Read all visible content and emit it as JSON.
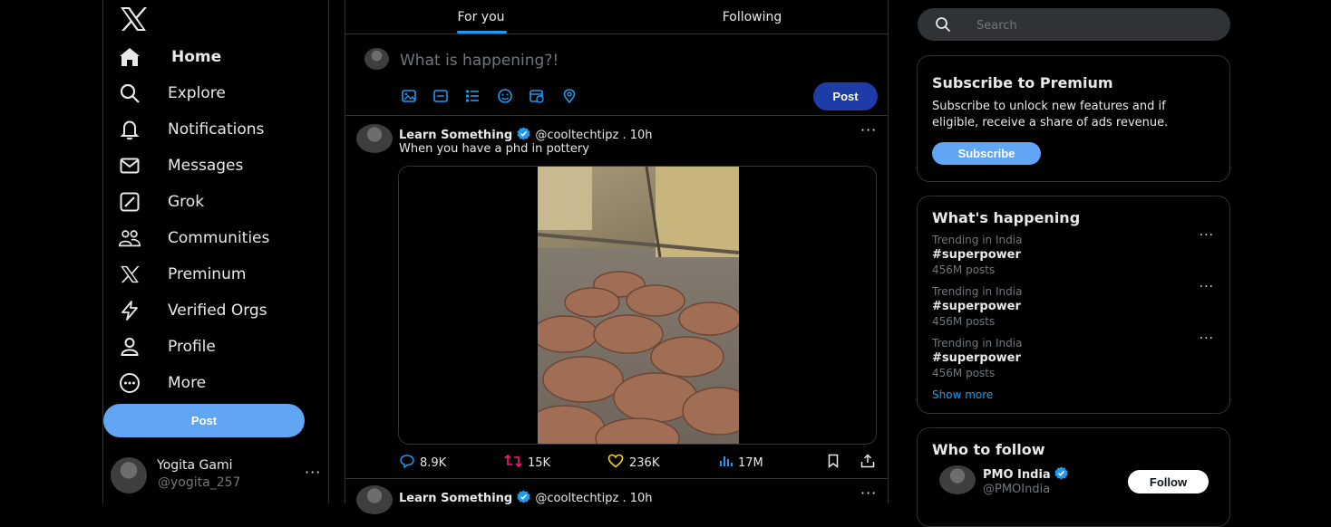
{
  "nav": {
    "items": [
      {
        "label": "Home",
        "icon": "home-icon"
      },
      {
        "label": "Explore",
        "icon": "search-icon"
      },
      {
        "label": "Notifications",
        "icon": "bell-icon"
      },
      {
        "label": "Messages",
        "icon": "mail-icon"
      },
      {
        "label": "Grok",
        "icon": "grok-icon"
      },
      {
        "label": "Communities",
        "icon": "communities-icon"
      },
      {
        "label": "Preminum",
        "icon": "x-logo-icon"
      },
      {
        "label": "Verified Orgs",
        "icon": "lightning-icon"
      },
      {
        "label": "Profile",
        "icon": "person-icon"
      },
      {
        "label": "More",
        "icon": "more-circle-icon"
      }
    ],
    "post_label": "Post"
  },
  "account": {
    "name": "Yogita Gami",
    "handle": "@yogita_257",
    "more": "···"
  },
  "tabs": [
    {
      "label": "For you"
    },
    {
      "label": "Following"
    }
  ],
  "compose": {
    "placeholder": "What is happening?!",
    "post_label": "Post",
    "tools": [
      "image-icon",
      "gif-icon",
      "poll-icon",
      "emoji-icon",
      "schedule-icon",
      "location-icon"
    ]
  },
  "tweet": {
    "name": "Learn Something",
    "handle": "@cooltechtipz . 10h",
    "text": "When you have a phd in pottery",
    "more": "···",
    "actions": {
      "replies": "8.9K",
      "reposts": "15K",
      "likes": "236K",
      "views": "17M"
    }
  },
  "tweet2": {
    "name": "Learn Something",
    "handle": "@cooltechtipz . 10h",
    "more": "···"
  },
  "search": {
    "placeholder": "Search"
  },
  "premium": {
    "title": "Subscribe to Premium",
    "description": "Subscribe to unlock new features and if eligible, receive a share of ads revenue.",
    "button": "Subscribe"
  },
  "happening": {
    "title": "What's happening",
    "trends": [
      {
        "context": "Trending in India",
        "tag": "#superpower",
        "count": "456M posts"
      },
      {
        "context": "Trending in India",
        "tag": "#superpower",
        "count": "456M posts"
      },
      {
        "context": "Trending in India",
        "tag": "#superpower",
        "count": "456M posts"
      }
    ],
    "show_more": "Show more"
  },
  "follow": {
    "title": "Who to follow",
    "suggestions": [
      {
        "name": "PMO India",
        "handle": "@PMOIndia",
        "button": "Follow"
      }
    ]
  },
  "colors": {
    "accent": "#1d9bf0",
    "button_light": "#61a6f5",
    "compose_post": "#1d3ca8",
    "border": "#2f3336",
    "muted": "#71767b",
    "reply": "#1d9bf0",
    "repost": "#f91880",
    "like": "#ffd400",
    "views": "#1d9bf0"
  }
}
